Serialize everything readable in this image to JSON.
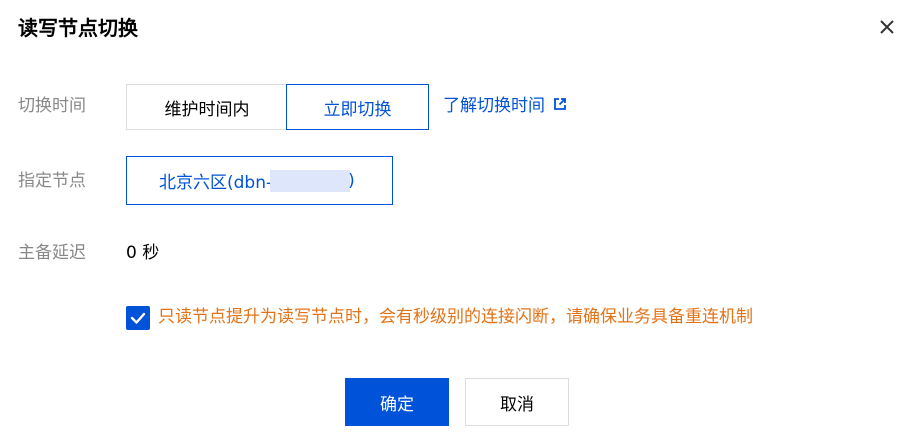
{
  "dialog": {
    "title": "读写节点切换"
  },
  "switch_time": {
    "label": "切换时间",
    "options": [
      "维护时间内",
      "立即切换"
    ],
    "selected": "立即切换",
    "help_link": "了解切换时间"
  },
  "node": {
    "label": "指定节点",
    "value_prefix": "北京六区(dbn-",
    "value_suffix": ")"
  },
  "delay": {
    "label": "主备延迟",
    "value": "0 秒"
  },
  "warning": {
    "checked": true,
    "text": "只读节点提升为读写节点时，会有秒级别的连接闪断，请确保业务具备重连机制"
  },
  "footer": {
    "confirm_label": "确定",
    "cancel_label": "取消"
  },
  "colors": {
    "primary": "#0052d9",
    "warning": "#e37318",
    "label": "#888888"
  },
  "icons": {
    "close": "close-icon",
    "external_link": "external-link-icon",
    "check": "check-icon"
  }
}
